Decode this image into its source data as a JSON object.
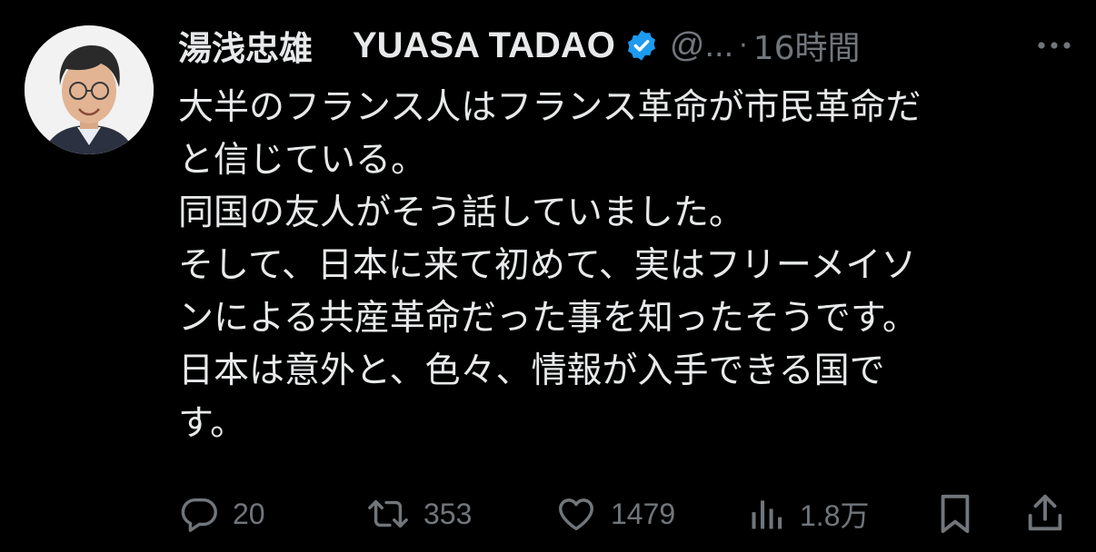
{
  "colors": {
    "background": "#000000",
    "text": "#e7e9ea",
    "muted": "#71767b",
    "verified": "#1d9bf0"
  },
  "tweet": {
    "author": {
      "display_name_jp": "湯浅忠雄",
      "display_name_en": "YUASA TADAO",
      "verified_icon": "verified-badge-icon",
      "handle": "@...",
      "separator": "·",
      "time": "16時間"
    },
    "text_lines": [
      "大半のフランス人はフランス革命が市民革命だ",
      "と信じている。",
      "同国の友人がそう話していました。",
      "そして、日本に来て初めて、実はフリーメイソ",
      "ンによる共産革命だった事を知ったそうです。",
      "日本は意外と、色々、情報が入手できる国で",
      "す。"
    ],
    "actions": {
      "reply": {
        "icon": "reply-icon",
        "count": "20"
      },
      "retweet": {
        "icon": "retweet-icon",
        "count": "353"
      },
      "like": {
        "icon": "heart-icon",
        "count": "1479"
      },
      "views": {
        "icon": "views-icon",
        "count": "1.8万"
      },
      "bookmark": {
        "icon": "bookmark-icon"
      },
      "share": {
        "icon": "share-icon"
      }
    },
    "more_icon": "more-icon"
  }
}
